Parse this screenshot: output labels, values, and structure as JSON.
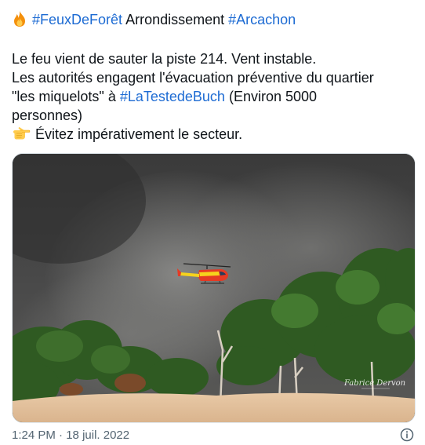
{
  "headline": {
    "icon": "fire-icon",
    "hashtag_1": "#FeuxDeForêt",
    "text": " Arrondissement ",
    "hashtag_2": "#Arcachon"
  },
  "body": {
    "line_1": "Le feu vient de sauter la piste 214. Vent instable.",
    "line_2": "Les autorités engagent l'évacuation préventive du quartier",
    "line_3_before": "\"les miquelots\" à ",
    "line_3_hashtag": "#LaTestedeBuch",
    "line_3_after": " (Environ 5000",
    "line_4": "personnes)",
    "line_5_icon": "pointing-hand-icon",
    "line_5": "Évitez impérativement le secteur."
  },
  "media": {
    "description_icon": "photo",
    "signature": "Fabrice Dervon"
  },
  "footer": {
    "time": "1:24 PM",
    "separator": " · ",
    "date": "18 juil. 2022",
    "info_icon": "info-icon"
  },
  "colors": {
    "hashtag": "#1d6bd3",
    "text": "#0f1419",
    "muted": "#536471"
  }
}
